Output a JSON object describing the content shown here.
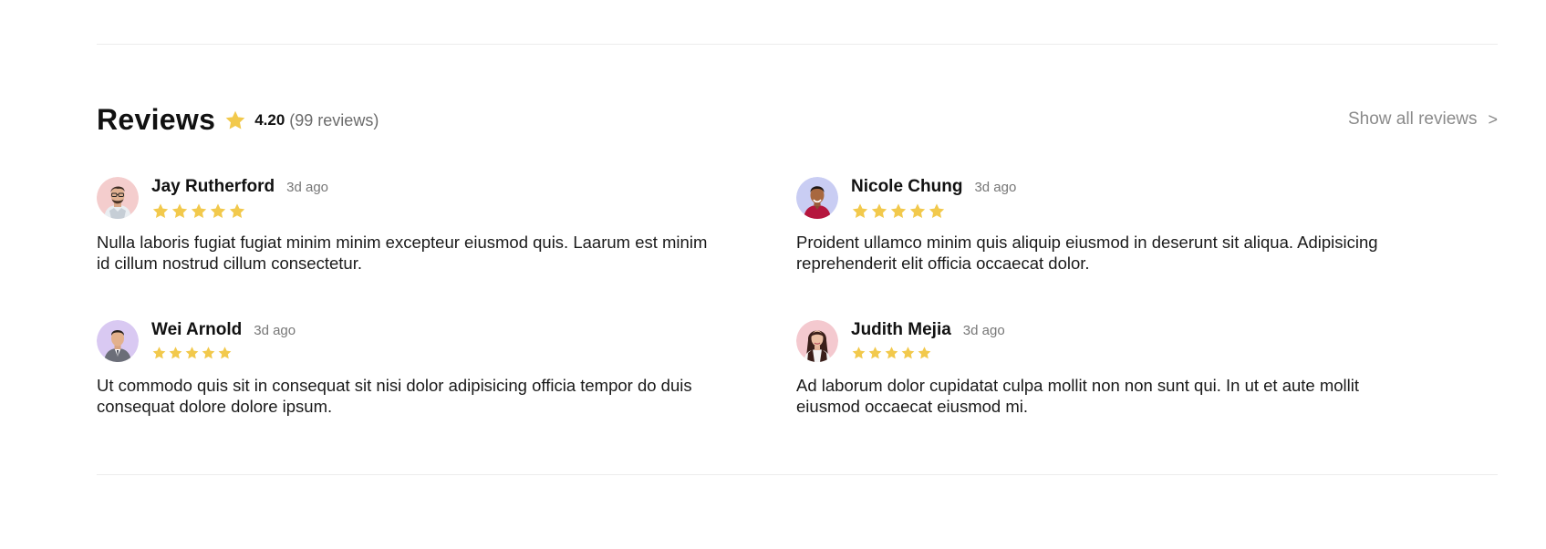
{
  "header": {
    "title": "Reviews",
    "rating": "4.20",
    "review_count": "99 reviews",
    "show_all_label": "Show all reviews",
    "show_all_chevron": ">"
  },
  "colors": {
    "star": "#f2c94c",
    "muted_text": "#8a8a8a",
    "divider": "#ececec"
  },
  "reviews": [
    {
      "name": "Jay Rutherford",
      "time": "3d ago",
      "stars": 5,
      "text": "Nulla laboris fugiat fugiat minim minim excepteur eiusmod quis. Laarum est minim id cillum nostrud cillum consectetur.",
      "avatar_icon": "avatar-man-glasses-icon"
    },
    {
      "name": "Nicole Chung",
      "time": "3d ago",
      "stars": 5,
      "text": "Proident ullamco minim quis aliquip eiusmod in deserunt sit aliqua. Adipisicing reprehenderit elit officia occaecat dolor.",
      "avatar_icon": "avatar-man-red-shirt-icon"
    },
    {
      "name": "Wei Arnold",
      "time": "3d ago",
      "stars": 5,
      "text": "Ut commodo quis sit in consequat sit nisi dolor adipisicing officia tempor do duis consequat dolore dolore ipsum.",
      "avatar_icon": "avatar-man-suit-icon"
    },
    {
      "name": "Judith Mejia",
      "time": "3d ago",
      "stars": 5,
      "text": "Ad laborum dolor cupidatat culpa mollit non non sunt qui. In ut et aute mollit eiusmod occaecat eiusmod mi.",
      "avatar_icon": "avatar-woman-long-hair-icon"
    }
  ]
}
